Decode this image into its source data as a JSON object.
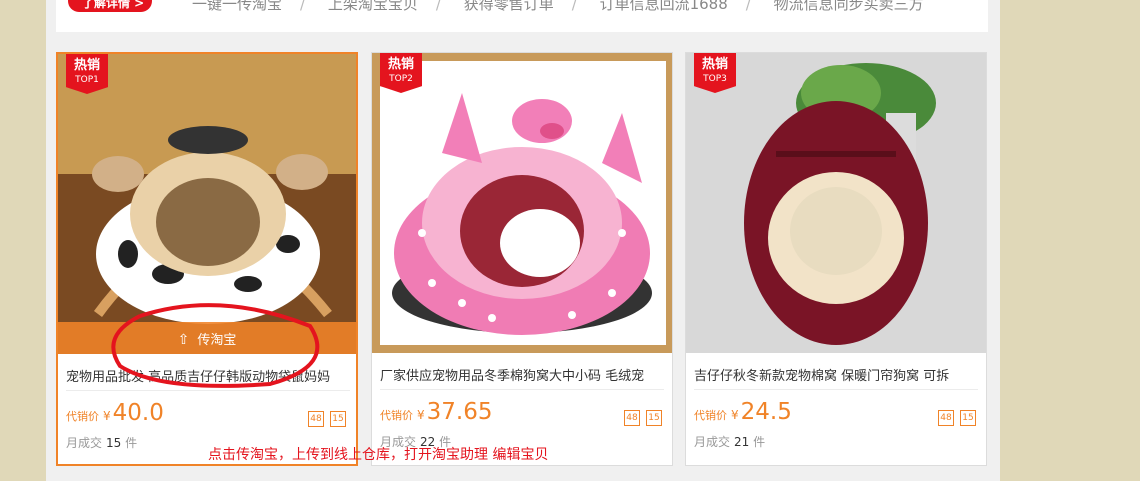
{
  "header": {
    "learn_more_label": "了解详情 >",
    "steps": [
      "一键一传淘宝",
      "上架淘宝宝贝",
      "获得零售订单",
      "订单信息回流1688",
      "物流信息同步买卖三方"
    ]
  },
  "products": [
    {
      "badge_top": "热销",
      "badge_rank": "TOP1",
      "upload_label": "传淘宝",
      "title": "宠物用品批发 高品质吉仔仔韩版动物袋鼠妈妈",
      "price_label": "代销价",
      "currency": "¥",
      "price": "40.0",
      "sales_label": "月成交",
      "sales_count": "15",
      "sales_unit": "件",
      "icon_labels": [
        "48",
        "15"
      ]
    },
    {
      "badge_top": "热销",
      "badge_rank": "TOP2",
      "title": "厂家供应宠物用品冬季棉狗窝大中小码 毛绒宠",
      "price_label": "代销价",
      "currency": "¥",
      "price": "37.65",
      "sales_label": "月成交",
      "sales_count": "22",
      "sales_unit": "件",
      "icon_labels": [
        "48",
        "15"
      ]
    },
    {
      "badge_top": "热销",
      "badge_rank": "TOP3",
      "title": "吉仔仔秋冬新款宠物棉窝 保暖门帘狗窝 可拆",
      "price_label": "代销价",
      "currency": "¥",
      "price": "24.5",
      "sales_label": "月成交",
      "sales_count": "21",
      "sales_unit": "件",
      "icon_labels": [
        "48",
        "15"
      ]
    }
  ],
  "annotation": "点击传淘宝，上传到线上仓库，打开淘宝助理 编辑宝贝",
  "colors": {
    "accent": "#f08328",
    "red": "#e4141e"
  }
}
